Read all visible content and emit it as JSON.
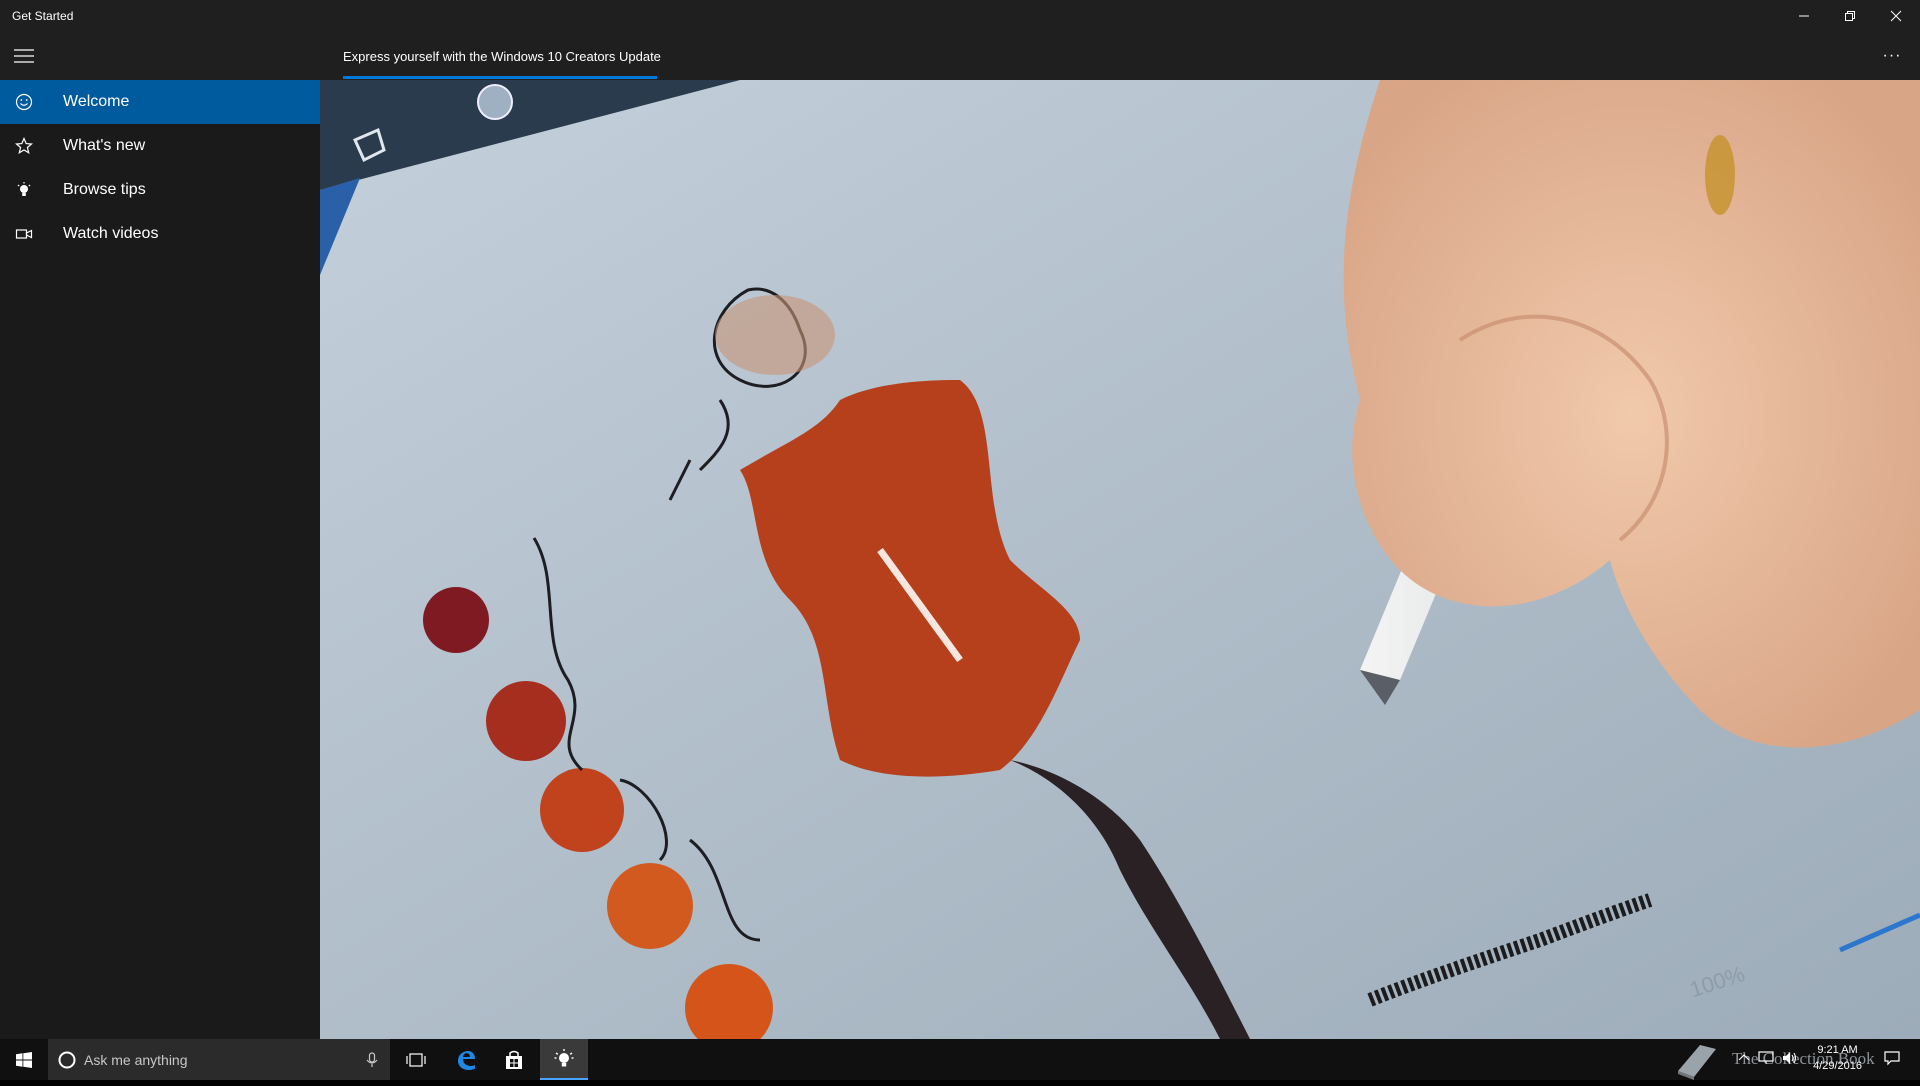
{
  "window": {
    "title": "Get Started",
    "minimize_icon": "minimize-icon",
    "restore_icon": "restore-icon",
    "close_icon": "close-icon"
  },
  "header": {
    "menu_icon": "hamburger-icon",
    "tab_label": "Express yourself with the Windows 10 Creators Update",
    "more_label": "···",
    "accent": "#0078d7"
  },
  "sidebar": {
    "items": [
      {
        "label": "Welcome",
        "icon": "smiley-icon",
        "selected": true
      },
      {
        "label": "What's new",
        "icon": "star-icon",
        "selected": false
      },
      {
        "label": "Browse tips",
        "icon": "lightbulb-icon",
        "selected": false
      },
      {
        "label": "Watch videos",
        "icon": "video-camera-icon",
        "selected": false
      }
    ],
    "selected_color": "#005a9e"
  },
  "content": {
    "image_description_icon": "video-still-icon",
    "zoom_readout": "100%"
  },
  "taskbar": {
    "start_icon": "windows-logo-icon",
    "search_placeholder": "Ask me anything",
    "cortana_icon": "cortana-circle-icon",
    "mic_icon": "microphone-icon",
    "task_view_icon": "task-view-icon",
    "edge_icon": "edge-icon",
    "store_icon": "store-icon",
    "get_started_icon": "lightbulb-icon",
    "time": "9:21 AM",
    "date": "4/29/2016",
    "watermark": "The Collection Book"
  }
}
